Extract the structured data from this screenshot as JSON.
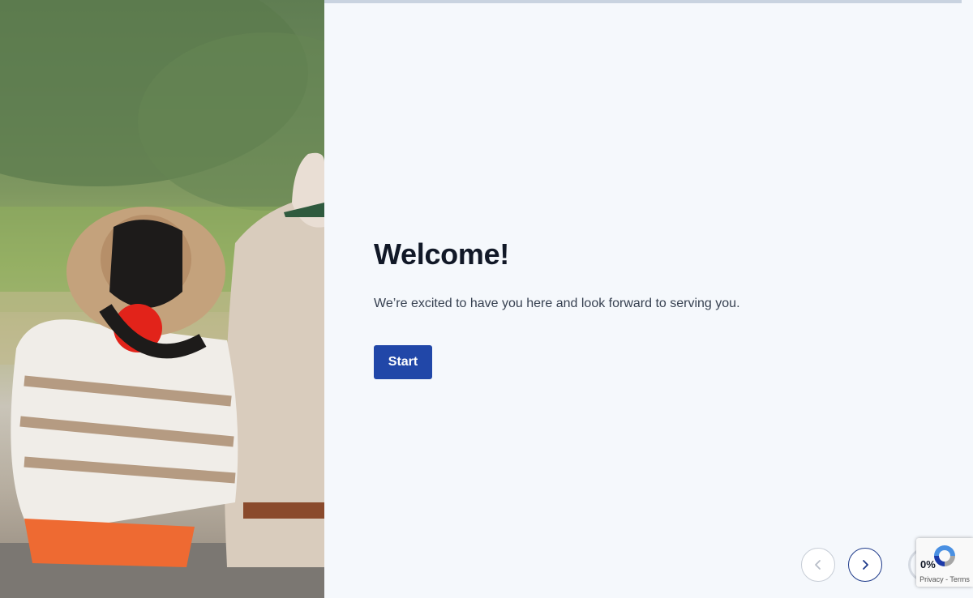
{
  "hero": {
    "image_label": "elderly couple sitting in a vineyard"
  },
  "welcome": {
    "title": "Welcome!",
    "subtitle": "We’re excited to have you here and look forward to serving you.",
    "start_label": "Start"
  },
  "navigation": {
    "prev_icon": "chevron-left-icon",
    "next_icon": "chevron-right-icon"
  },
  "progress": {
    "label": "0%",
    "value": 0
  },
  "recaptcha": {
    "links": "Privacy - Terms"
  },
  "colors": {
    "accent": "#2147a8",
    "background": "#f5f8fc",
    "title": "#111827",
    "next_border": "#1e3a8a"
  }
}
